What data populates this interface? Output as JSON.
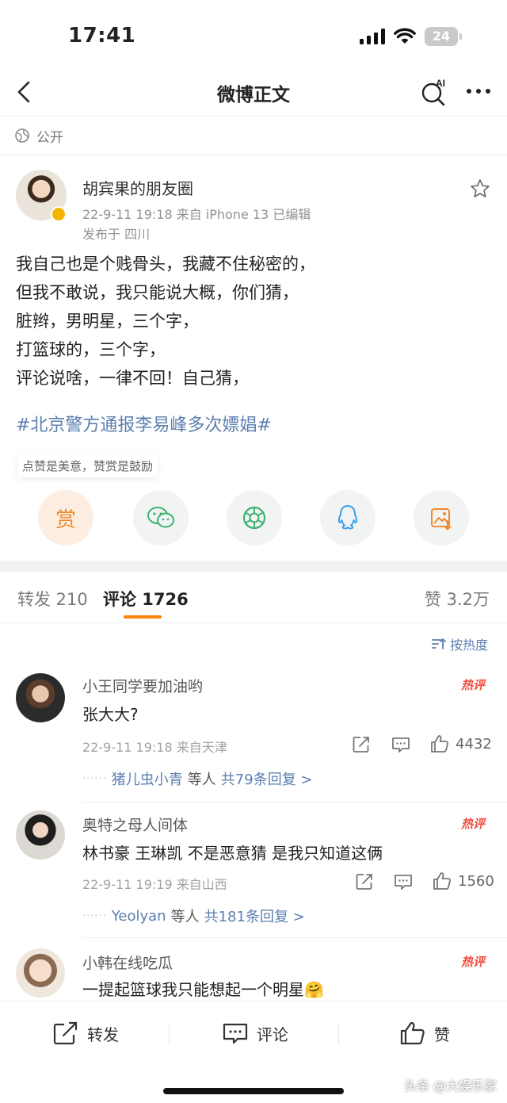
{
  "status_bar": {
    "time": "17:41",
    "battery": "24"
  },
  "nav": {
    "title": "微博正文"
  },
  "visibility": "公开",
  "post": {
    "author": "胡宾果的朋友圈",
    "meta": "22-9-11 19:18  来自 iPhone 13  已编辑",
    "location": "发布于 四川",
    "lines": [
      "我自己也是个贱骨头，我藏不住秘密的，",
      "但我不敢说，我只能说大概，你们猜，",
      "脏辫，男明星，三个字，",
      "打篮球的，三个字，",
      "评论说啥，一律不回！自己猜，"
    ],
    "hashtag": "#北京警方通报李易峰多次嫖娼#"
  },
  "reward": {
    "tip": "点赞是美意，赞赏是鼓励",
    "button": "赏"
  },
  "tabs": {
    "repost": "转发 210",
    "comment": "评论 1726",
    "like": "赞 3.2万"
  },
  "sort": "按热度",
  "comments": [
    {
      "name": "小王同学要加油哟",
      "text": "张大大?",
      "meta": "22-9-11 19:18  来自天津",
      "likes": "4432",
      "badge": "热评",
      "replies_user": "猪儿虫小青",
      "replies_mid": "等人",
      "replies_count": "共79条回复 >"
    },
    {
      "name": "奥特之母人间体",
      "text": "林书豪 王琳凯 不是恶意猜 是我只知道这俩",
      "meta": "22-9-11 19:19  来自山西",
      "likes": "1560",
      "badge": "热评",
      "replies_user": "Yeolyan",
      "replies_mid": "等人",
      "replies_count": "共181条回复 >"
    },
    {
      "name": "小韩在线吃瓜",
      "text": "一提起篮球我只能想起一个明星🤗",
      "badge": "热评"
    }
  ],
  "bottom_bar": {
    "repost": "转发",
    "comment": "评论",
    "like": "赞"
  },
  "watermark": "头条 @大娱乐家",
  "colors": {
    "accent": "#ff8200",
    "link": "#5b7fb0",
    "hot": "#f04b3a"
  }
}
